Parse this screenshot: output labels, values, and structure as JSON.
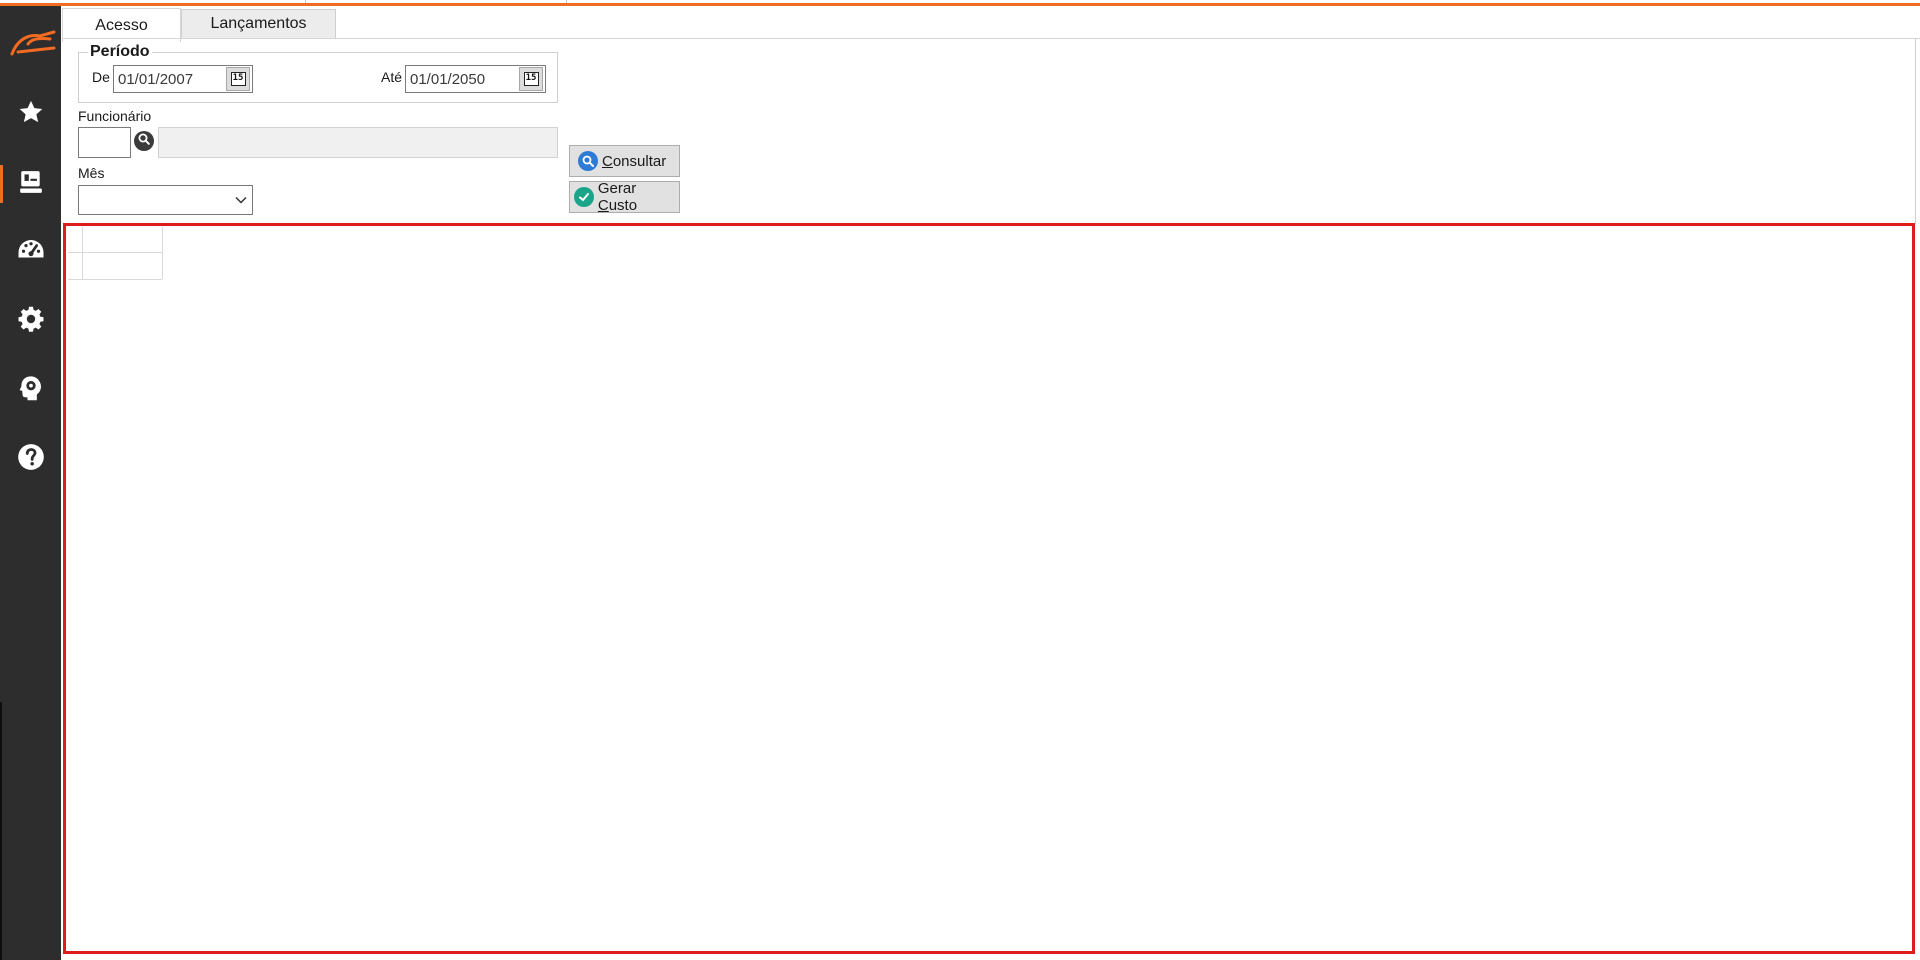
{
  "tabs": [
    {
      "label": "Acesso",
      "active": true
    },
    {
      "label": "Lançamentos",
      "active": false
    }
  ],
  "periodo": {
    "title": "Período",
    "from_label": "De",
    "from_value": "01/01/2007",
    "to_label": "Até",
    "to_value": "01/01/2050",
    "calendar_icon": "calendar-icon"
  },
  "funcionario": {
    "label": "Funcionário",
    "code_value": "",
    "name_value": "",
    "lookup_icon": "search-icon"
  },
  "mes": {
    "label": "Mês",
    "selected": ""
  },
  "buttons": {
    "consultar": {
      "first": "C",
      "rest": "onsultar",
      "icon": "search-icon"
    },
    "gerar_custo": {
      "prefix": "Gerar ",
      "first": "C",
      "rest": "usto",
      "icon": "check-circle-icon"
    }
  },
  "sidebar": {
    "items": [
      {
        "name": "favorites",
        "icon": "star-icon"
      },
      {
        "name": "records",
        "icon": "register-icon",
        "active": true
      },
      {
        "name": "dashboard",
        "icon": "speedometer-icon"
      },
      {
        "name": "settings",
        "icon": "gear-icon"
      },
      {
        "name": "support",
        "icon": "head-gear-icon"
      },
      {
        "name": "help",
        "icon": "help-icon"
      }
    ]
  },
  "colors": {
    "accent": "#f26b22",
    "sidebar_bg": "#2d2d2d",
    "grid_highlight": "#e01b1b",
    "consultar_icon": "#2e7bd6",
    "gerar_icon": "#1aa58a"
  }
}
